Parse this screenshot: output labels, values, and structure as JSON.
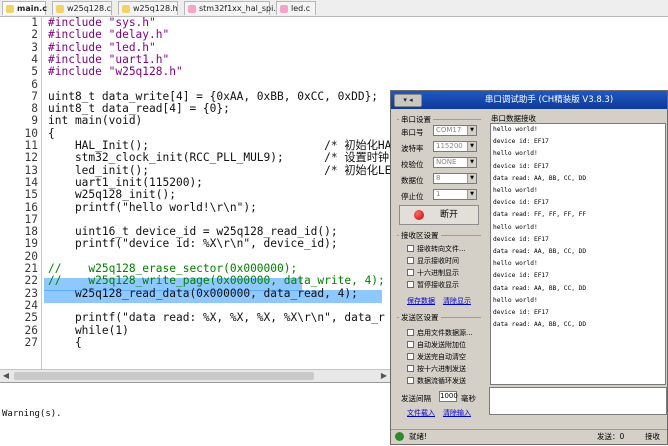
{
  "editor": {
    "tabs": [
      {
        "label": "main.c",
        "active": true,
        "color": "#f5d16a"
      },
      {
        "label": "w25q128.c",
        "active": false,
        "color": "#f5d16a"
      },
      {
        "label": "w25q128.h",
        "active": false,
        "color": "#f5d16a"
      },
      {
        "label": "stm32f1xx_hal_spi.c",
        "active": false,
        "color": "#f5a3c9"
      },
      {
        "label": "led.c",
        "active": false,
        "color": "#f5a3c9"
      }
    ],
    "lines": [
      {
        "n": "1",
        "text": "#include \"sys.h\""
      },
      {
        "n": "2",
        "text": "#include \"delay.h\""
      },
      {
        "n": "3",
        "text": "#include \"led.h\""
      },
      {
        "n": "4",
        "text": "#include \"uart1.h\""
      },
      {
        "n": "5",
        "text": "#include \"w25q128.h\""
      },
      {
        "n": "6",
        "text": ""
      },
      {
        "n": "7",
        "text": "uint8_t data_write[4] = {0xAA, 0xBB, 0xCC, 0xDD};"
      },
      {
        "n": "8",
        "text": "uint8_t data_read[4] = {0};"
      },
      {
        "n": "9",
        "text": "int main(void)"
      },
      {
        "n": "10",
        "text": "{"
      },
      {
        "n": "11",
        "text": "    HAL_Init();                          /* 初始化HA"
      },
      {
        "n": "12",
        "text": "    stm32_clock_init(RCC_PLL_MUL9);      /* 设置时钟"
      },
      {
        "n": "13",
        "text": "    led_init();                          /* 初始化LE"
      },
      {
        "n": "14",
        "text": "    uart1_init(115200);"
      },
      {
        "n": "15",
        "text": "    w25q128_init();"
      },
      {
        "n": "16",
        "text": "    printf(\"hello world!\\r\\n\");"
      },
      {
        "n": "17",
        "text": ""
      },
      {
        "n": "18",
        "text": "    uint16_t device_id = w25q128_read_id();"
      },
      {
        "n": "19",
        "text": "    printf(\"device id: %X\\r\\n\", device_id);"
      },
      {
        "n": "20",
        "text": ""
      },
      {
        "n": "21",
        "text": "//    w25q128_erase_sector(0x000000);"
      },
      {
        "n": "22",
        "text": "//    w25q128_write_page(0x000000, data_write, 4);"
      },
      {
        "n": "23",
        "text": "    w25q128_read_data(0x000000, data_read, 4);"
      },
      {
        "n": "24",
        "text": ""
      },
      {
        "n": "25",
        "text": "    printf(\"data read: %X, %X, %X, %X\\r\\n\", data_r"
      },
      {
        "n": "26",
        "text": "    while(1)"
      },
      {
        "n": "27",
        "text": "    {"
      }
    ],
    "build_output": "Warning(s)."
  },
  "serial": {
    "title": "串口调试助手 (CH精装版 V3.8.3)",
    "sysmenu": "▾ ◂",
    "port_group": "串口设置",
    "port_label": "串口号",
    "port_value": "COM17",
    "baud_label": "波特率",
    "baud_value": "115200",
    "parity_label": "校验位",
    "parity_value": "NONE",
    "databits_label": "数据位",
    "databits_value": "8",
    "stopbits_label": "停止位",
    "stopbits_value": "1",
    "open_button": "断开",
    "recv_group": "接收区设置",
    "recv_opts": [
      "接收转向文件...",
      "显示接收时间",
      "十六进制显示",
      "暂停接收显示"
    ],
    "save_data": "保存数据",
    "clear_display": "清除显示",
    "send_group": "发送区设置",
    "send_opts": [
      "启用文件数据源...",
      "自动发送附加位",
      "发送完自动清空",
      "按十六进制发送",
      "数据流循环发送"
    ],
    "interval_label": "发送间隔",
    "interval_value": "1000",
    "interval_unit": "毫秒",
    "file_load": "文件载入",
    "clear_input": "清除输入",
    "recv_title": "串口数据接收",
    "recv_lines": [
      "hello world!",
      "device id: EF17",
      "hello world!",
      "device id: EF17",
      "data read: AA, BB, CC, DD",
      "hello world!",
      "device id: EF17",
      "data read: FF, FF, FF, FF",
      "hello world!",
      "device id: EF17",
      "data read: AA, BB, CC, DD",
      "hello world!",
      "device id: EF17",
      "data read: AA, BB, CC, DD",
      "hello world!",
      "device id: EF17",
      "data read: AA, BB, CC, DD"
    ],
    "status_text": "就绪!",
    "send_count": "发送：0",
    "recv_count": "接收"
  }
}
